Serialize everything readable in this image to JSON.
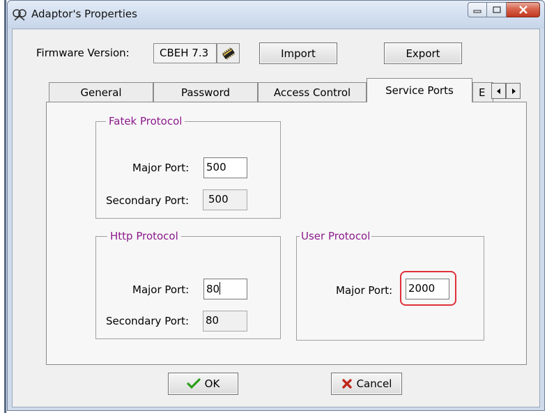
{
  "window": {
    "title": "Adaptor's Properties",
    "caption_buttons": {
      "minimize_icon": "minimize-icon",
      "maximize_icon": "maximize-icon",
      "close_icon": "close-icon"
    }
  },
  "firmware": {
    "label": "Firmware Version:",
    "value": "CBEH 7.3",
    "icon": "chip-icon"
  },
  "toolbar": {
    "import_label": "Import",
    "export_label": "Export"
  },
  "tabs": [
    {
      "label": "General",
      "active": false
    },
    {
      "label": "Password",
      "active": false
    },
    {
      "label": "Access Control",
      "active": false
    },
    {
      "label": "Service Ports",
      "active": true
    },
    {
      "label": "E",
      "active": false
    }
  ],
  "fatek": {
    "title": "Fatek Protocol",
    "major_label": "Major Port:",
    "major_value": "500",
    "secondary_label": "Secondary Port:",
    "secondary_value": "500"
  },
  "http": {
    "title": "Http Protocol",
    "major_label": "Major Port:",
    "major_value": "80",
    "secondary_label": "Secondary Port:",
    "secondary_value": "80"
  },
  "user": {
    "title": "User Protocol",
    "major_label": "Major Port:",
    "major_value": "2000"
  },
  "footer": {
    "ok_label": "OK",
    "cancel_label": "Cancel"
  },
  "colors": {
    "group_title": "#8b1a8b",
    "highlight": "#e0303a",
    "ok_check": "#2e9e1a",
    "cancel_x": "#c0281c"
  }
}
